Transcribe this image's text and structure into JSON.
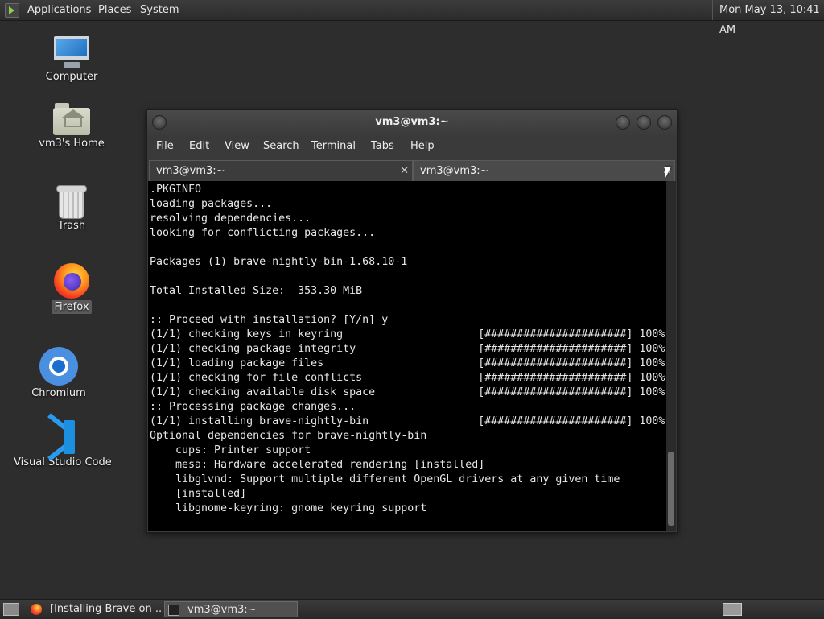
{
  "top_panel": {
    "menus": [
      "Applications",
      "Places",
      "System"
    ],
    "clock": "Mon May 13, 10:41 AM"
  },
  "desktop": {
    "icons": [
      {
        "label": "Computer",
        "icon": "computer-icon"
      },
      {
        "label": "vm3's Home",
        "icon": "home-folder-icon"
      },
      {
        "label": "Trash",
        "icon": "trash-icon"
      },
      {
        "label": "Firefox",
        "icon": "firefox-icon"
      },
      {
        "label": "Chromium",
        "icon": "chromium-icon"
      },
      {
        "label": "Visual Studio Code",
        "icon": "vscode-icon"
      }
    ]
  },
  "terminal": {
    "title": "vm3@vm3:~",
    "menu": [
      "File",
      "Edit",
      "View",
      "Search",
      "Terminal",
      "Tabs",
      "Help"
    ],
    "tabs": [
      {
        "label": "vm3@vm3:~",
        "close": "✕"
      },
      {
        "label": "vm3@vm3:~",
        "close": "✕"
      }
    ],
    "lines": [
      ".PKGINFO",
      "loading packages...",
      "resolving dependencies...",
      "looking for conflicting packages...",
      "",
      "Packages (1) brave-nightly-bin-1.68.10-1",
      "",
      "Total Installed Size:  353.30 MiB",
      "",
      ":: Proceed with installation? [Y/n] y",
      "(1/1) checking keys in keyring                     [######################] 100%",
      "(1/1) checking package integrity                   [######################] 100%",
      "(1/1) loading package files                        [######################] 100%",
      "(1/1) checking for file conflicts                  [######################] 100%",
      "(1/1) checking available disk space                [######################] 100%",
      ":: Processing package changes...",
      "(1/1) installing brave-nightly-bin                 [######################] 100%",
      "Optional dependencies for brave-nightly-bin",
      "    cups: Printer support",
      "    mesa: Hardware accelerated rendering [installed]",
      "    libglvnd: Support multiple different OpenGL drivers at any given time",
      "    [installed]",
      "    libgnome-keyring: gnome keyring support"
    ]
  },
  "taskbar": {
    "tasks": [
      {
        "label": "[Installing Brave on ...",
        "icon": "firefox-icon",
        "active": false
      },
      {
        "label": "vm3@vm3:~",
        "icon": "terminal-icon",
        "active": true
      }
    ]
  }
}
